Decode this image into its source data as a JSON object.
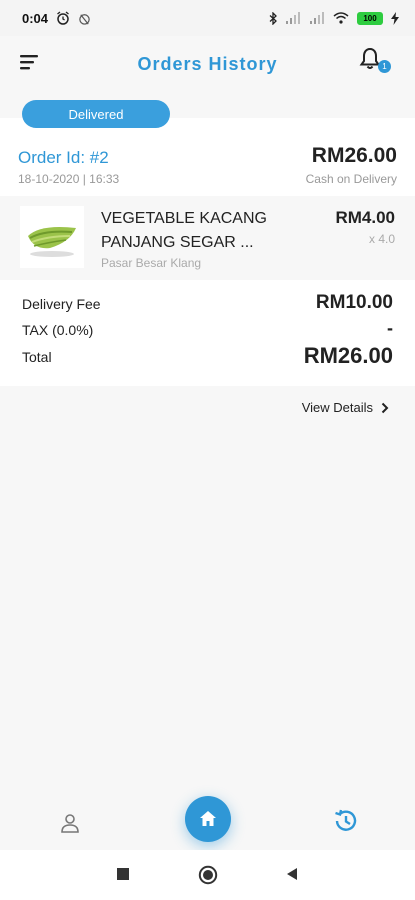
{
  "status_bar": {
    "time": "0:04",
    "battery": "100"
  },
  "header": {
    "title": "Orders History",
    "notification_count": "1",
    "menu_icon": "menu-icon",
    "bell_icon": "bell-icon"
  },
  "order": {
    "status": "Delivered",
    "id_label": "Order Id: #2",
    "date": "18-10-2020 | 16:33",
    "total_amount": "RM26.00",
    "payment_method": "Cash on Delivery",
    "items": [
      {
        "name": "VEGETABLE KACANG PANJANG SEGAR ...",
        "shop": "Pasar Besar Klang",
        "price": "RM4.00",
        "qty": "x 4.0"
      }
    ],
    "summary": {
      "delivery_fee_label": "Delivery Fee",
      "delivery_fee_value": "RM10.00",
      "tax_label": "TAX (0.0%)",
      "tax_value": "-",
      "total_label": "Total",
      "total_value": "RM26.00"
    },
    "view_details_label": "View Details"
  },
  "bottom_nav": {
    "items": [
      "profile-icon",
      "home-icon",
      "history-icon"
    ],
    "active": "home"
  },
  "colors": {
    "accent": "#2f97d6",
    "pill": "#3a9fdd",
    "battery": "#2ecc40"
  }
}
